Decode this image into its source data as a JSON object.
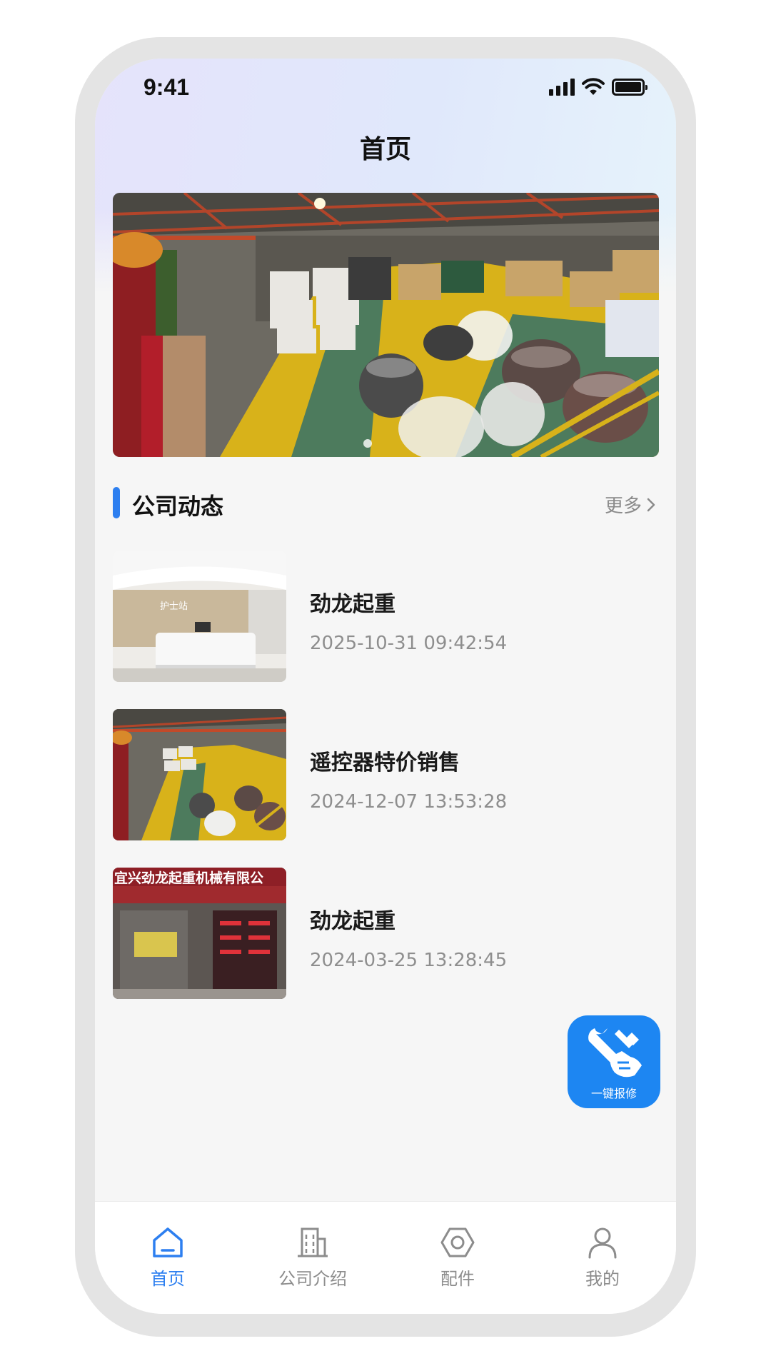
{
  "status_bar": {
    "time": "9:41"
  },
  "header": {
    "title": "首页"
  },
  "section": {
    "title": "公司动态",
    "more_label": "更多"
  },
  "news": [
    {
      "title": "劲龙起重",
      "time": "2025-10-31 09:42:54"
    },
    {
      "title": "遥控器特价销售",
      "time": "2024-12-07 13:53:28"
    },
    {
      "title": "劲龙起重",
      "time": "2024-03-25 13:28:45"
    }
  ],
  "news_thumb_texts": {
    "reception_sign": "护士站",
    "storefront_sign": "宜兴劲龙起重机械有限公"
  },
  "repair_button": {
    "label": "一键报修"
  },
  "tabs": [
    {
      "label": "首页",
      "icon": "home-icon",
      "active": true
    },
    {
      "label": "公司介绍",
      "icon": "building-icon",
      "active": false
    },
    {
      "label": "配件",
      "icon": "nut-icon",
      "active": false
    },
    {
      "label": "我的",
      "icon": "user-icon",
      "active": false
    }
  ],
  "colors": {
    "accent": "#2d7ff0",
    "fab": "#1d86f2",
    "inactive": "#8c8c8c"
  }
}
